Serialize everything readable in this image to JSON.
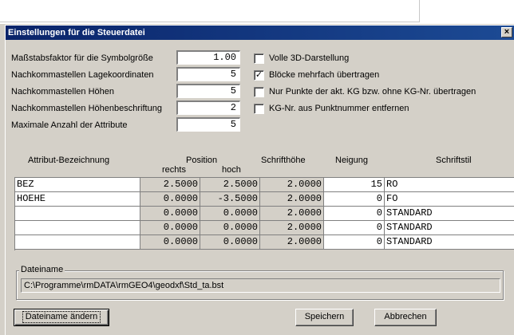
{
  "window": {
    "title": "Einstellungen für die Steuerdatei",
    "close_glyph": "×"
  },
  "settings": [
    {
      "label": "Maßstabsfaktor für die Symbolgröße",
      "value": "1.00"
    },
    {
      "label": "Nachkommastellen Lagekoordinaten",
      "value": "5"
    },
    {
      "label": "Nachkommastellen Höhen",
      "value": "5"
    },
    {
      "label": "Nachkommastellen Höhenbeschriftung",
      "value": "2"
    },
    {
      "label": "Maximale Anzahl der Attribute",
      "value": "5"
    }
  ],
  "options": [
    {
      "label": "Volle 3D-Darstellung",
      "checked": false
    },
    {
      "label": "Blöcke mehrfach übertragen",
      "checked": true
    },
    {
      "label": "Nur Punkte der akt. KG bzw. ohne KG-Nr. übertragen",
      "checked": false
    },
    {
      "label": "KG-Nr. aus Punktnummer entfernen",
      "checked": false
    }
  ],
  "table": {
    "headers": {
      "name": "Attribut-Bezeichnung",
      "position": "Position",
      "right": "rechts",
      "up": "hoch",
      "height": "Schrifthöhe",
      "tilt": "Neigung",
      "style": "Schriftstil"
    },
    "rows": [
      {
        "name": "BEZ",
        "right": "2.5000",
        "up": "2.5000",
        "height": "2.0000",
        "tilt": "15",
        "style": "RO"
      },
      {
        "name": "HOEHE",
        "right": "0.0000",
        "up": "-3.5000",
        "height": "2.0000",
        "tilt": "0",
        "style": "FO"
      },
      {
        "name": "",
        "right": "0.0000",
        "up": "0.0000",
        "height": "2.0000",
        "tilt": "0",
        "style": "STANDARD"
      },
      {
        "name": "",
        "right": "0.0000",
        "up": "0.0000",
        "height": "2.0000",
        "tilt": "0",
        "style": "STANDARD"
      },
      {
        "name": "",
        "right": "0.0000",
        "up": "0.0000",
        "height": "2.0000",
        "tilt": "0",
        "style": "STANDARD"
      }
    ]
  },
  "file": {
    "group_label": "Dateiname",
    "path": "C:\\Programme\\rmDATA\\rmGEO4\\geodxf\\Std_ta.bst"
  },
  "buttons": {
    "change": "Dateiname ändern",
    "save": "Speichern",
    "cancel": "Abbrechen"
  }
}
